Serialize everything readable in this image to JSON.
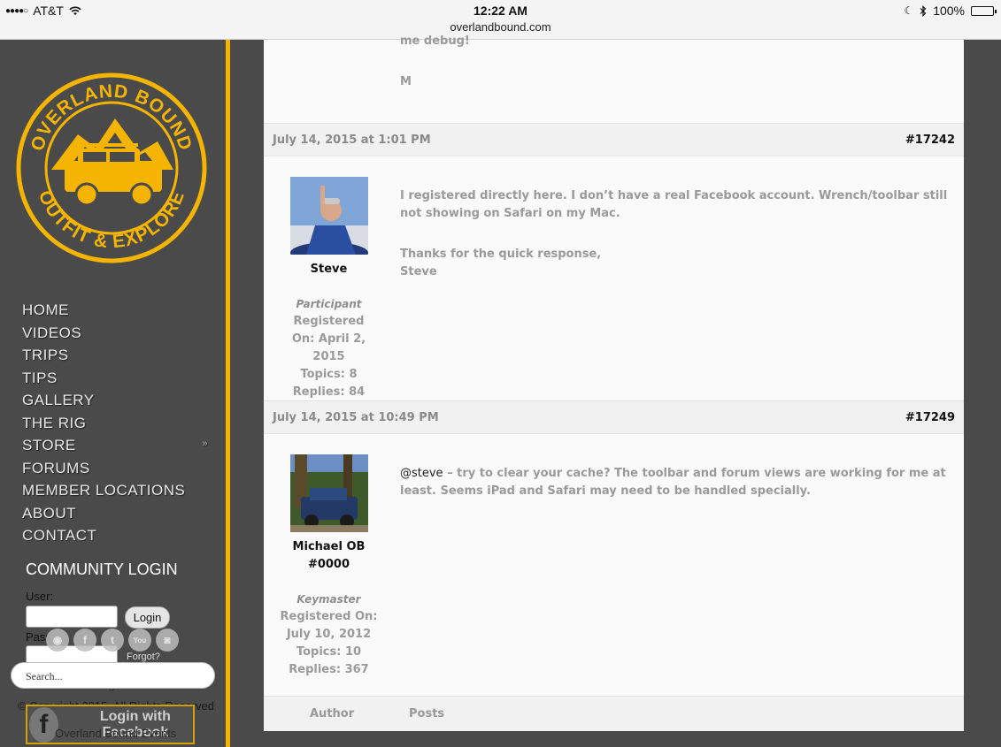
{
  "statusbar": {
    "carrier": "AT&T",
    "time": "12:22 AM",
    "url": "overlandbound.com",
    "battery": "100%"
  },
  "logo": {
    "top_text": "OVERLAND BOUND",
    "bottom_text": "OUTFIT & EXPLORE",
    "gold": "#f4b400",
    "dark": "#4a4a4a"
  },
  "nav": {
    "items": [
      "HOME",
      "VIDEOS",
      "TRIPS",
      "TIPS",
      "GALLERY",
      "THE RIG",
      "STORE",
      "FORUMS",
      "MEMBER LOCATIONS",
      "ABOUT",
      "CONTACT"
    ],
    "store_chevron": "»"
  },
  "login": {
    "heading": "COMMUNITY LOGIN",
    "user_label": "User:",
    "pass_label": "Pass",
    "button": "Login",
    "forgot": "Forgot?",
    "remember": "Remember - Register",
    "search_placeholder": "Search...",
    "copyright": "© Copyright 2015, All Rights Reserved",
    "facebook_button": "Login with Facebook",
    "overland_link": "Overland Bound Events"
  },
  "posts": [
    {
      "intro_lines": [
        "me debug!",
        "M"
      ]
    },
    {
      "date": "July 14, 2015 at 1:01 PM",
      "id": "#17242",
      "author": "Steve",
      "role": "Participant",
      "registered": "Registered On: April 2, 2015",
      "topics": "Topics: 8",
      "replies": "Replies: 84",
      "paragraph1": "I registered directly here. I don’t have a real Facebook account. Wrench/toolbar still not showing on Safari on my Mac.",
      "paragraph2_line1": "Thanks for the quick response,",
      "paragraph2_line2": "Steve"
    },
    {
      "date": "July 14, 2015 at 10:49 PM",
      "id": "#17249",
      "author": "Michael OB #0000",
      "role": "Keymaster",
      "registered": "Registered On: July 10, 2012",
      "topics": "Topics: 10",
      "replies": "Replies: 367",
      "mention": "@steve",
      "paragraph1": " – try to clear your cache? The toolbar and forum views are working for me at least. Seems iPad and Safari may need to be handled specially."
    }
  ],
  "footer": {
    "author_col": "Author",
    "posts_col": "Posts"
  }
}
